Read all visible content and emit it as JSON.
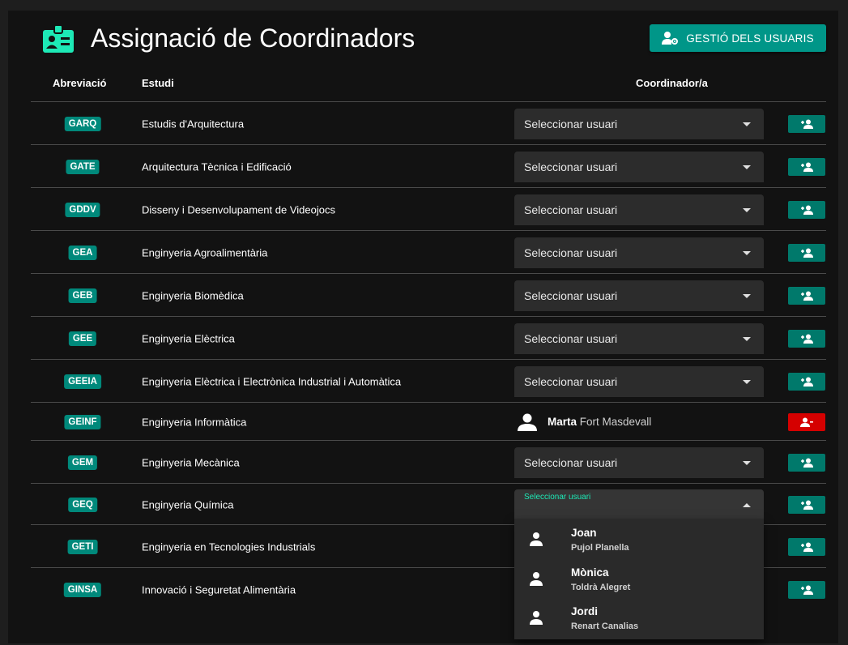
{
  "header": {
    "title": "Assignació de Coordinadors",
    "manage_users_label": "GESTIÓ DELS USUARIS"
  },
  "columns": {
    "abbr": "Abreviació",
    "study": "Estudi",
    "coordinator": "Coordinador/a"
  },
  "rows": [
    {
      "abbr": "GARQ",
      "study": "Estudis d'Arquitectura",
      "select": "Seleccionar usuari"
    },
    {
      "abbr": "GATE",
      "study": "Arquitectura Tècnica i Edificació",
      "select": "Seleccionar usuari"
    },
    {
      "abbr": "GDDV",
      "study": "Disseny i Desenvolupament de Videojocs",
      "select": "Seleccionar usuari"
    },
    {
      "abbr": "GEA",
      "study": "Enginyeria Agroalimentària",
      "select": "Seleccionar usuari"
    },
    {
      "abbr": "GEB",
      "study": "Enginyeria Biomèdica",
      "select": "Seleccionar usuari"
    },
    {
      "abbr": "GEE",
      "study": "Enginyeria Elèctrica",
      "select": "Seleccionar usuari"
    },
    {
      "abbr": "GEEIA",
      "study": "Enginyeria Elèctrica i Electrònica Industrial i Automàtica",
      "select": "Seleccionar usuari"
    },
    {
      "abbr": "GEINF",
      "study": "Enginyeria Informàtica",
      "coordinator_first": "Marta",
      "coordinator_last": "Fort Masdevall"
    },
    {
      "abbr": "GEM",
      "study": "Enginyeria Mecànica",
      "select": "Seleccionar usuari"
    },
    {
      "abbr": "GEQ",
      "study": "Enginyeria Química",
      "select": "Seleccionar usuari"
    },
    {
      "abbr": "GETI",
      "study": "Enginyeria en Tecnologies Industrials"
    },
    {
      "abbr": "GINSA",
      "study": "Innovació i Seguretat Alimentària"
    }
  ],
  "dropdown": {
    "options": [
      {
        "first": "Joan",
        "last": "Pujol Planella"
      },
      {
        "first": "Mònica",
        "last": "Toldrà Alegret"
      },
      {
        "first": "Jordi",
        "last": "Renart Canalias"
      }
    ]
  },
  "colors": {
    "accent": "#009688",
    "add_button": "#00796b",
    "remove_button": "#d50000",
    "focus": "#1de9b6",
    "background": "#121212"
  }
}
